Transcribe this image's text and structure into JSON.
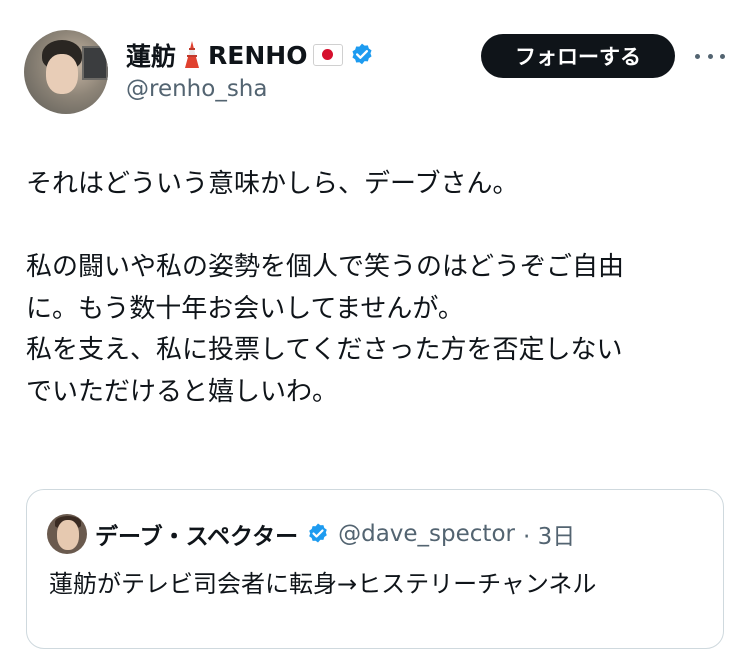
{
  "author": {
    "display_name": "蓮舫",
    "display_name_suffix": "RENHO",
    "handle": "@renho_sha"
  },
  "actions": {
    "follow_label": "フォローする"
  },
  "tweet": {
    "lines": [
      "それはどういう意味かしら、デーブさん。",
      "",
      "私の闘いや私の姿勢を個人で笑うのはどうぞご自由",
      "に。もう数十年お会いしてませんが。",
      "私を支え、私に投票してくださった方を否定しない",
      "でいただけると嬉しいわ。"
    ]
  },
  "quote": {
    "display_name": "デーブ・スペクター",
    "handle": "@dave_spector",
    "time": "· 3日",
    "text": "蓮舫がテレビ司会者に転身→ヒステリーチャンネル"
  },
  "colors": {
    "verified_blue": "#1d9bf0",
    "follow_button_bg": "#0f1419",
    "secondary_text": "#536471"
  },
  "icons": [
    "tokyo-tower-icon",
    "japan-flag-icon",
    "verified-badge-icon",
    "more-options-icon"
  ]
}
